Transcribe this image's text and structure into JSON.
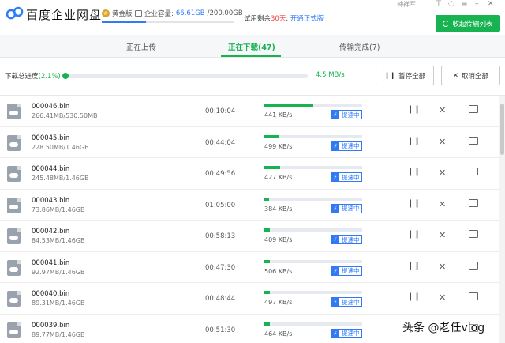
{
  "header": {
    "brand": "百度企业网盘",
    "plan": "黄金版",
    "capacity_label": "企业容量:",
    "capacity_used": "66.61GB",
    "capacity_total": "/200.00GB",
    "capacity_fraction": 0.333,
    "trial_prefix": "试用剩余",
    "trial_days": "30天",
    "trial_sep": ",",
    "trial_open": "开通正式版",
    "username": "钟祥军",
    "collapse_label": "收起传输列表"
  },
  "tabs": [
    {
      "label": "正在上传"
    },
    {
      "label": "正在下载(47)"
    },
    {
      "label": "传输完成(7)"
    }
  ],
  "total": {
    "label": "下载总进度",
    "percent_text": "(2.1%)",
    "percent": 0.021,
    "speed": "4.5 MB/s",
    "pause_all": "暂停全部",
    "cancel_all": "取消全部"
  },
  "boost_label": "提速中",
  "files": [
    {
      "name": "000046.bin",
      "size": "266.41MB/530.50MB",
      "time": "00:10:04",
      "speed": "441 KB/s",
      "progress": 0.5
    },
    {
      "name": "000045.bin",
      "size": "228.50MB/1.46GB",
      "time": "00:44:04",
      "speed": "499 KB/s",
      "progress": 0.15
    },
    {
      "name": "000044.bin",
      "size": "245.48MB/1.46GB",
      "time": "00:49:56",
      "speed": "427 KB/s",
      "progress": 0.16
    },
    {
      "name": "000043.bin",
      "size": "73.86MB/1.46GB",
      "time": "01:05:00",
      "speed": "384 KB/s",
      "progress": 0.05
    },
    {
      "name": "000042.bin",
      "size": "84.53MB/1.46GB",
      "time": "00:58:13",
      "speed": "409 KB/s",
      "progress": 0.06
    },
    {
      "name": "000041.bin",
      "size": "92.97MB/1.46GB",
      "time": "00:47:30",
      "speed": "506 KB/s",
      "progress": 0.06
    },
    {
      "name": "000040.bin",
      "size": "89.31MB/1.46GB",
      "time": "00:48:44",
      "speed": "497 KB/s",
      "progress": 0.06
    },
    {
      "name": "000039.bin",
      "size": "89.77MB/1.46GB",
      "time": "00:51:30",
      "speed": "464 KB/s",
      "progress": 0.06
    }
  ],
  "watermark": "头条 @老任vlog"
}
